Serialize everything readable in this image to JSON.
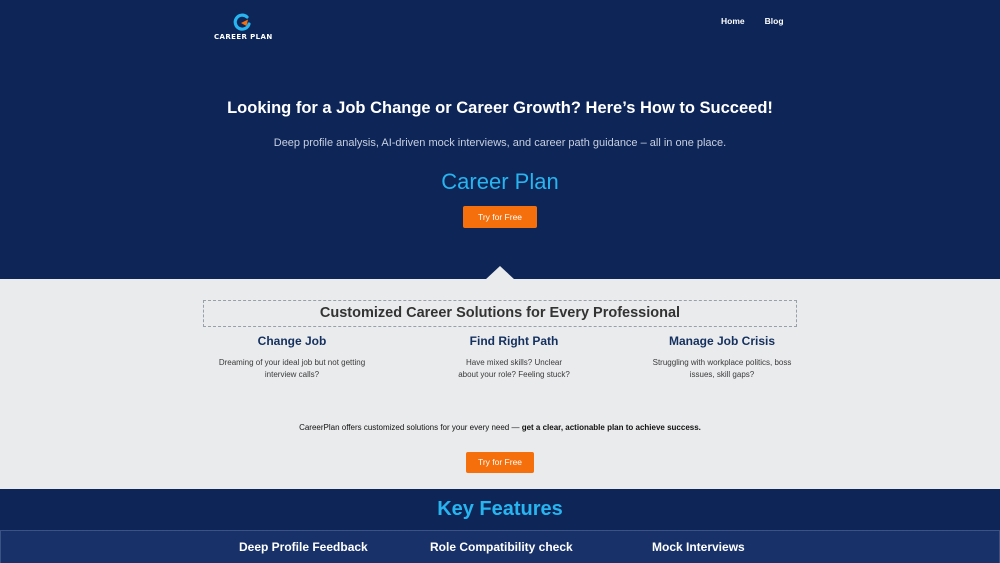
{
  "brand": {
    "logo_text": "CAREER PLAN"
  },
  "nav": {
    "items": [
      "Home",
      "Blog"
    ]
  },
  "hero": {
    "title": "Looking for a Job Change or Career Growth? Here’s How to Succeed!",
    "subtitle": "Deep profile analysis, AI-driven mock interviews, and career path guidance – all in one place.",
    "brand_name": "Career Plan",
    "cta_label": "Try for Free"
  },
  "solutions": {
    "title": "Customized Career Solutions for Every Professional",
    "columns": [
      {
        "heading": "Change Job",
        "text": "Dreaming of your ideal job but not getting interview calls?"
      },
      {
        "heading": "Find Right Path",
        "text": "Have mixed skills? Unclear about your role? Feeling stuck?"
      },
      {
        "heading": "Manage Job Crisis",
        "text": "Struggling with workplace politics, boss issues,  skill gaps?"
      }
    ],
    "note_prefix": "CareerPlan offers customized solutions for your every need — ",
    "note_bold": "get a clear, actionable plan to achieve success.",
    "cta_label": "Try for Free"
  },
  "features": {
    "title": "Key Features",
    "items": [
      "Deep Profile Feedback",
      "Role Compatibility check",
      "Mock Interviews"
    ]
  },
  "colors": {
    "navy": "#0e2557",
    "accent_blue": "#27b4ef",
    "cta_orange": "#f5700c",
    "light_section": "#eaebed"
  }
}
